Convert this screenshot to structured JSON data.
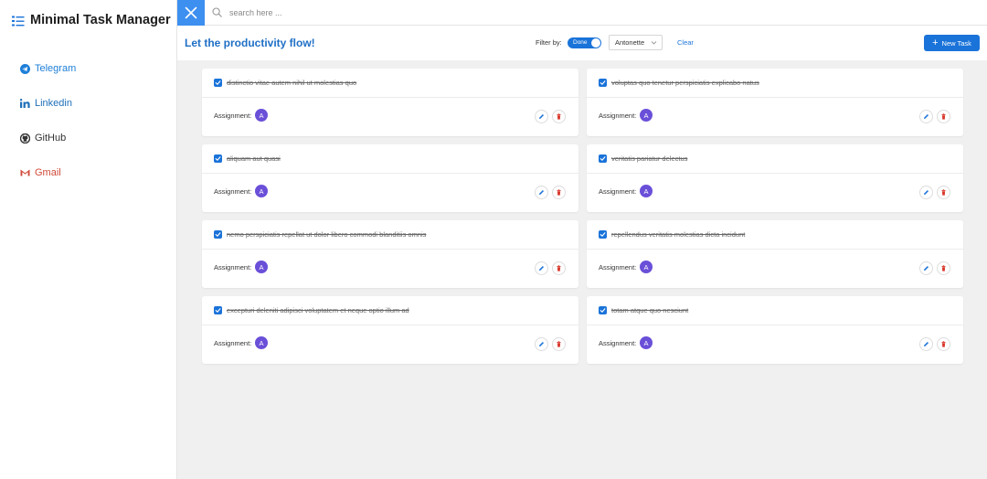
{
  "app": {
    "title": "Minimal Task Manager"
  },
  "sidebar": {
    "items": [
      {
        "label": "Telegram",
        "icon": "telegram-icon"
      },
      {
        "label": "Linkedin",
        "icon": "linkedin-icon"
      },
      {
        "label": "GitHub",
        "icon": "github-icon"
      },
      {
        "label": "Gmail",
        "icon": "gmail-icon"
      }
    ]
  },
  "search": {
    "placeholder": "search here ...",
    "value": ""
  },
  "header": {
    "title": "Let the productivity flow!",
    "filter_label": "Filter by:",
    "toggle_label": "Done",
    "toggle_on": true,
    "assignee_selected": "Antonette",
    "clear_label": "Clear",
    "new_task_label": "New Task"
  },
  "tasks": [
    {
      "title": "distinctio vitae autem nihil ut molestias quo",
      "done": true,
      "assignment_label": "Assignment:",
      "avatar": "A"
    },
    {
      "title": "voluptas quo tenetur perspiciatis explicabo natus",
      "done": true,
      "assignment_label": "Assignment:",
      "avatar": "A"
    },
    {
      "title": "aliquam aut quasi",
      "done": true,
      "assignment_label": "Assignment:",
      "avatar": "A"
    },
    {
      "title": "veritatis pariatur delectus",
      "done": true,
      "assignment_label": "Assignment:",
      "avatar": "A"
    },
    {
      "title": "nemo perspiciatis repellat ut dolor libero commodi blanditiis omnis",
      "done": true,
      "assignment_label": "Assignment:",
      "avatar": "A"
    },
    {
      "title": "repellendus veritatis molestias dicta incidunt",
      "done": true,
      "assignment_label": "Assignment:",
      "avatar": "A"
    },
    {
      "title": "excepturi deleniti adipisci voluptatem et neque optio illum ad",
      "done": true,
      "assignment_label": "Assignment:",
      "avatar": "A"
    },
    {
      "title": "totam atque quo nesciunt",
      "done": true,
      "assignment_label": "Assignment:",
      "avatar": "A"
    }
  ],
  "colors": {
    "accent": "#1a73d9",
    "close_button": "#3d8ff0",
    "avatar": "#6a4fd8",
    "delete": "#d9382c",
    "title": "#1f6fc6"
  }
}
